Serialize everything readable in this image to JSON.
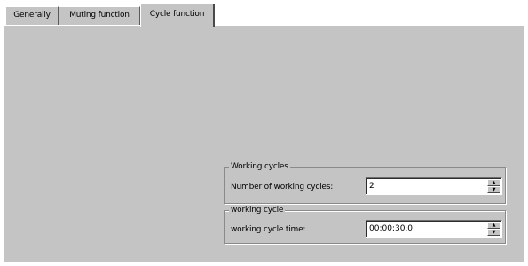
{
  "tabs": [
    {
      "label": "Generally",
      "active": false
    },
    {
      "label": "Muting function",
      "active": false
    },
    {
      "label": "Cycle function",
      "active": true
    }
  ],
  "working_cycles_group": {
    "title": "Working cycles",
    "field_label": "Number of working cycles:",
    "value": "2"
  },
  "working_cycle_group": {
    "title": "working cycle",
    "field_label": "working cycle time:",
    "value": "00:00:30,0"
  },
  "icons": {
    "spin_up": "up-arrow-icon",
    "spin_down": "down-arrow-icon"
  },
  "colors": {
    "dialog_face": "#c4c4c4",
    "field_background": "#ffffff"
  }
}
